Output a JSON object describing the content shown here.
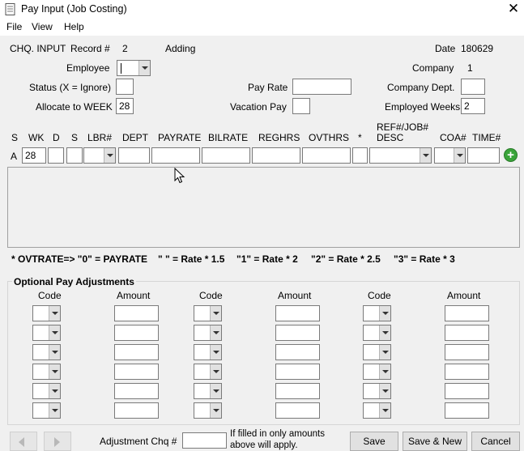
{
  "window": {
    "title": "Pay Input (Job Costing)",
    "close_glyph": "✕"
  },
  "menu": {
    "file": "File",
    "view": "View",
    "help": "Help"
  },
  "header": {
    "chq_input": "CHQ. INPUT",
    "record_label": "Record #",
    "record_value": "2",
    "mode": "Adding",
    "date_label": "Date",
    "date_value": "180629",
    "employee_label": "Employee",
    "company_label": "Company",
    "company_value": "1",
    "status_label": "Status (X = Ignore)",
    "pay_rate_label": "Pay Rate",
    "company_dept_label": "Company Dept.",
    "allocate_label": "Allocate to WEEK",
    "allocate_value": "28",
    "vacation_label": "Vacation Pay",
    "employed_weeks_label": "Employed Weeks",
    "employed_weeks_value": "2"
  },
  "columns": {
    "s1": "S",
    "wk": "WK",
    "d": "D",
    "s2": "S",
    "lbr": "LBR#",
    "dept": "DEPT",
    "payrate": "PAYRATE",
    "bilrate": "BILRATE",
    "reghrs": "REGHRS",
    "ovthrs": "OVTHRS",
    "star": "*",
    "ref1": "REF#/JOB#",
    "ref2": "DESC",
    "coa": "COA#",
    "time": "TIME#"
  },
  "entry_row": {
    "row_label": "A",
    "wk_value": "28"
  },
  "ovtrate_note": {
    "n0": "* OVTRATE=>  \"0\" = PAYRATE",
    "n1": "\" \" = Rate * 1.5",
    "n2": "\"1\" = Rate * 2",
    "n3": "\"2\" = Rate * 2.5",
    "n4": "\"3\" = Rate * 3"
  },
  "adjustments": {
    "title": "Optional Pay Adjustments",
    "code_label": "Code",
    "amount_label": "Amount"
  },
  "footer": {
    "adj_chq_label": "Adjustment Chq #",
    "note_line1": "If filled in only amounts",
    "note_line2": "above will apply.",
    "save": "Save",
    "save_new": "Save & New",
    "cancel": "Cancel"
  },
  "colors": {
    "add_button": "#3aa43a"
  }
}
